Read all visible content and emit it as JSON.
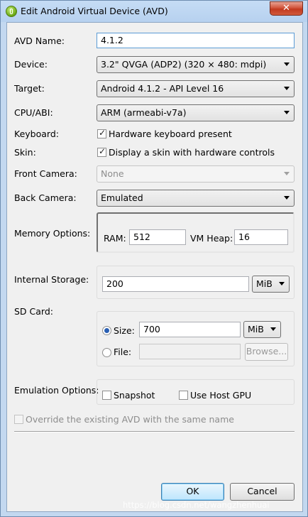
{
  "window": {
    "title": "Edit Android Virtual Device (AVD)",
    "close_glyph": "✕"
  },
  "fields": {
    "avd_name": {
      "label": "AVD Name:",
      "value": "4.1.2"
    },
    "device": {
      "label": "Device:",
      "value": "3.2\" QVGA (ADP2) (320 × 480: mdpi)"
    },
    "target": {
      "label": "Target:",
      "value": "Android 4.1.2 - API Level 16"
    },
    "cpu_abi": {
      "label": "CPU/ABI:",
      "value": "ARM (armeabi-v7a)"
    },
    "keyboard": {
      "label": "Keyboard:",
      "checkbox_label": "Hardware keyboard present",
      "checked": true
    },
    "skin": {
      "label": "Skin:",
      "checkbox_label": "Display a skin with hardware controls",
      "checked": true
    },
    "front_camera": {
      "label": "Front Camera:",
      "value": "None"
    },
    "back_camera": {
      "label": "Back Camera:",
      "value": "Emulated"
    }
  },
  "memory": {
    "label": "Memory Options:",
    "ram_label": "RAM:",
    "ram_value": "512",
    "vm_heap_label": "VM Heap:",
    "vm_heap_value": "16"
  },
  "internal_storage": {
    "label": "Internal Storage:",
    "value": "200",
    "unit": "MiB"
  },
  "sd_card": {
    "label": "SD Card:",
    "size_label": "Size:",
    "size_value": "700",
    "size_unit": "MiB",
    "size_selected": true,
    "file_label": "File:",
    "file_value": "",
    "browse_label": "Browse..."
  },
  "emulation": {
    "label": "Emulation Options:",
    "snapshot_label": "Snapshot",
    "host_gpu_label": "Use Host GPU"
  },
  "override": {
    "label": "Override the existing AVD with the same name"
  },
  "buttons": {
    "ok": "OK",
    "cancel": "Cancel"
  },
  "watermark": "https://blog.csdn.net/wangzhenhuai",
  "colors": {
    "titlebar": "#b7d1ef",
    "close": "#c23a1f",
    "client_bg": "#f0f0f0",
    "focus_border": "#5b9bd5"
  }
}
